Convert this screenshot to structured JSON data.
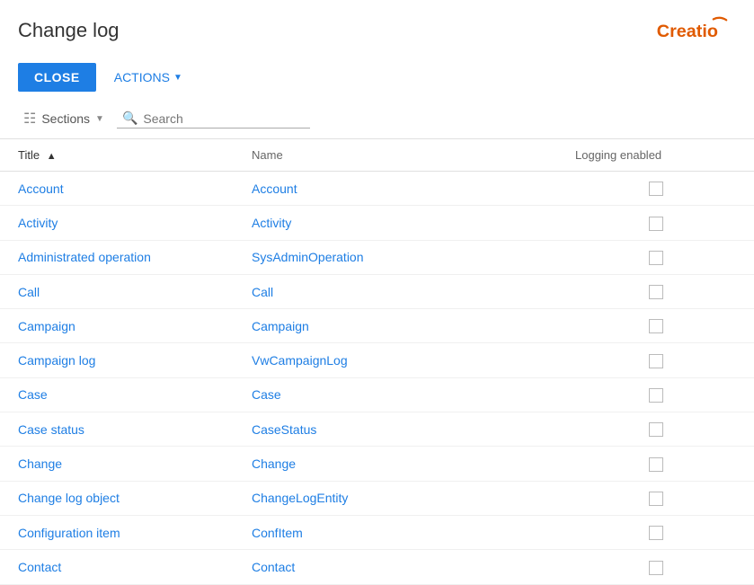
{
  "header": {
    "title": "Change log",
    "logo_text": "Creatio"
  },
  "toolbar": {
    "close_label": "CLOSE",
    "actions_label": "ACTIONS"
  },
  "filter_bar": {
    "sections_label": "Sections",
    "search_placeholder": "Search"
  },
  "table": {
    "columns": [
      {
        "key": "title",
        "label": "Title",
        "sortable": true,
        "sort_direction": "asc"
      },
      {
        "key": "name",
        "label": "Name",
        "sortable": false
      },
      {
        "key": "logging_enabled",
        "label": "Logging enabled",
        "sortable": false
      }
    ],
    "rows": [
      {
        "title": "Account",
        "name": "Account",
        "logging_enabled": false
      },
      {
        "title": "Activity",
        "name": "Activity",
        "logging_enabled": false
      },
      {
        "title": "Administrated operation",
        "name": "SysAdminOperation",
        "logging_enabled": false
      },
      {
        "title": "Call",
        "name": "Call",
        "logging_enabled": false
      },
      {
        "title": "Campaign",
        "name": "Campaign",
        "logging_enabled": false
      },
      {
        "title": "Campaign log",
        "name": "VwCampaignLog",
        "logging_enabled": false
      },
      {
        "title": "Case",
        "name": "Case",
        "logging_enabled": false
      },
      {
        "title": "Case status",
        "name": "CaseStatus",
        "logging_enabled": false
      },
      {
        "title": "Change",
        "name": "Change",
        "logging_enabled": false
      },
      {
        "title": "Change log object",
        "name": "ChangeLogEntity",
        "logging_enabled": false
      },
      {
        "title": "Configuration item",
        "name": "ConfItem",
        "logging_enabled": false
      },
      {
        "title": "Contact",
        "name": "Contact",
        "logging_enabled": false
      }
    ]
  },
  "colors": {
    "accent": "#1e7ee4",
    "close_btn_bg": "#1e7ee4",
    "close_btn_text": "#ffffff"
  }
}
